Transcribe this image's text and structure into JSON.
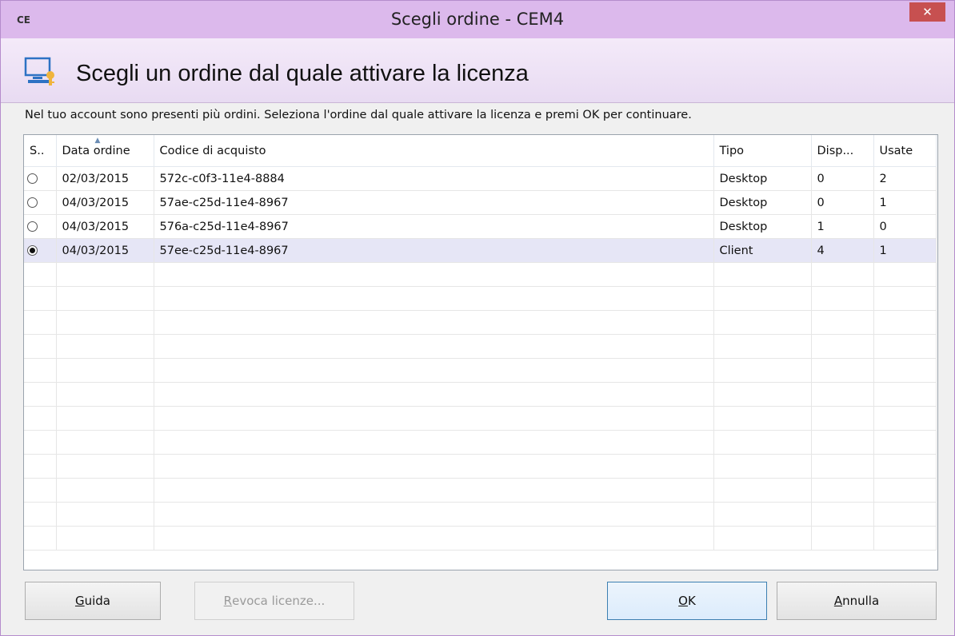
{
  "window": {
    "title": "Scegli ordine - CEM4",
    "app_icon": "CE",
    "close_label": "✕"
  },
  "header": {
    "title": "Scegli un ordine dal quale attivare la licenza",
    "icon": "computer-key-icon"
  },
  "instruction": "Nel tuo account sono presenti più ordini. Seleziona l'ordine dal quale attivare la licenza e premi OK per continuare.",
  "grid": {
    "columns": [
      "S..",
      "Data ordine",
      "Codice di acquisto",
      "Tipo",
      "Disp...",
      "Usate"
    ],
    "sorted_column": "Data ordine",
    "rows": [
      {
        "selected": false,
        "data": "02/03/2015",
        "codice": "572c-c0f3-11e4-8884",
        "tipo": "Desktop",
        "disp": "0",
        "usate": "2"
      },
      {
        "selected": false,
        "data": "04/03/2015",
        "codice": "57ae-c25d-11e4-8967",
        "tipo": "Desktop",
        "disp": "0",
        "usate": "1"
      },
      {
        "selected": false,
        "data": "04/03/2015",
        "codice": "576a-c25d-11e4-8967",
        "tipo": "Desktop",
        "disp": "1",
        "usate": "0"
      },
      {
        "selected": true,
        "data": "04/03/2015",
        "codice": "57ee-c25d-11e4-8967",
        "tipo": "Client",
        "disp": "4",
        "usate": "1"
      }
    ]
  },
  "buttons": {
    "guida": {
      "first": "G",
      "rest": "uida"
    },
    "revoca": {
      "first": "R",
      "rest": "evoca licenze..."
    },
    "ok": {
      "first": "O",
      "rest": "K"
    },
    "annulla": {
      "first": "A",
      "rest": "nnulla"
    }
  },
  "colors": {
    "titlebar": "#dcb9ec",
    "close": "#c75050",
    "selected_row": "#e6e6f6",
    "default_button_border": "#3c7fb1"
  }
}
